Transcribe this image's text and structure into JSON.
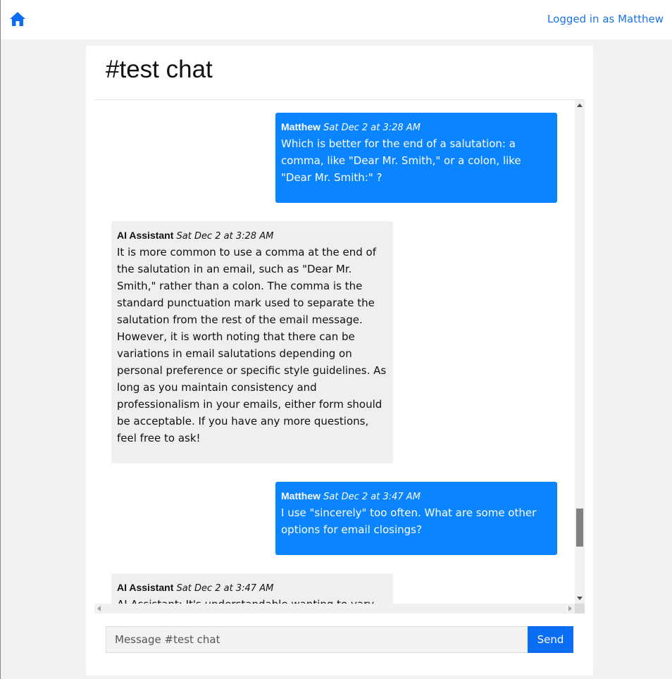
{
  "header": {
    "home_icon": "home-icon",
    "logged_in_text": "Logged in as Matthew"
  },
  "chat": {
    "title": "#test chat",
    "messages": [
      {
        "role": "user",
        "sender": "Matthew",
        "timestamp": "Sat Dec 2 at 3:28 AM",
        "text": "Which is better for the end of a salutation: a comma, like \"Dear Mr. Smith,\" or a colon, like \"Dear Mr. Smith:\" ?"
      },
      {
        "role": "ai",
        "sender": "AI Assistant",
        "timestamp": "Sat Dec 2 at 3:28 AM",
        "text": "It is more common to use a comma at the end of the salutation in an email, such as \"Dear Mr. Smith,\" rather than a colon. The comma is the standard punctuation mark used to separate the salutation from the rest of the email message. However, it is worth noting that there can be variations in email salutations depending on personal preference or specific style guidelines. As long as you maintain consistency and professionalism in your emails, either form should be acceptable. If you have any more questions, feel free to ask!"
      },
      {
        "role": "user",
        "sender": "Matthew",
        "timestamp": "Sat Dec 2 at 3:47 AM",
        "text": "I use \"sincerely\" too often. What are some other options for email closings?"
      },
      {
        "role": "ai",
        "sender": "AI Assistant",
        "timestamp": "Sat Dec 2 at 3:47 AM",
        "text": "AI Assistant: It's understandable wanting to vary"
      }
    ]
  },
  "composer": {
    "placeholder": "Message #test chat",
    "send_label": "Send"
  },
  "colors": {
    "user_bubble": "#0a84ff",
    "ai_bubble": "#efefef",
    "accent": "#0a6ef5"
  }
}
